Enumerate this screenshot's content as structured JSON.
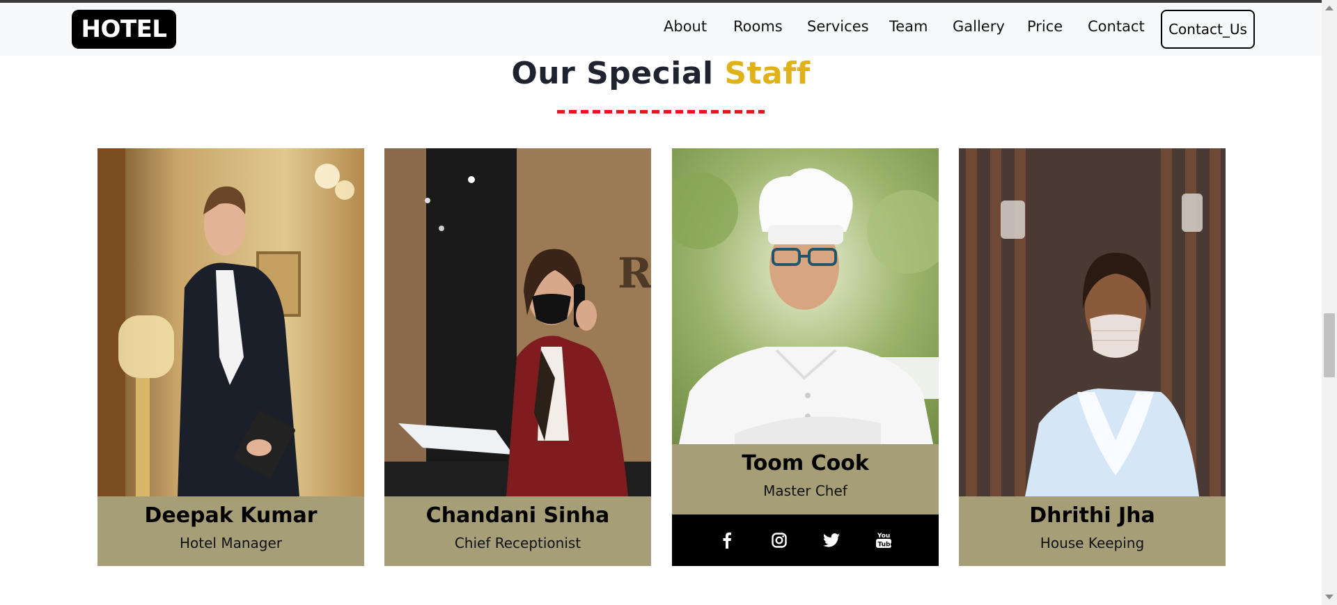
{
  "navbar": {
    "brand": "HOTEL",
    "links": [
      "About",
      "Rooms",
      "Services",
      "Team",
      "Gallery",
      "Price",
      "Contact"
    ],
    "cta_label": "Contact_Us"
  },
  "section": {
    "title_main": "Our Special",
    "title_accent": "Staff"
  },
  "staff": [
    {
      "name": "Deepak Kumar",
      "role": "Hotel Manager"
    },
    {
      "name": "Chandani Sinha",
      "role": "Chief Receptionist"
    },
    {
      "name": "Toom Cook",
      "role": "Master Chef",
      "social": [
        "facebook-icon",
        "instagram-icon",
        "twitter-icon",
        "youtube-icon"
      ]
    },
    {
      "name": "Dhrithi Jha",
      "role": "House Keeping"
    }
  ],
  "colors": {
    "accent": "#e0b21a",
    "card_band": "#a59e76",
    "divider": "#e8141c",
    "title": "#1f2330"
  }
}
